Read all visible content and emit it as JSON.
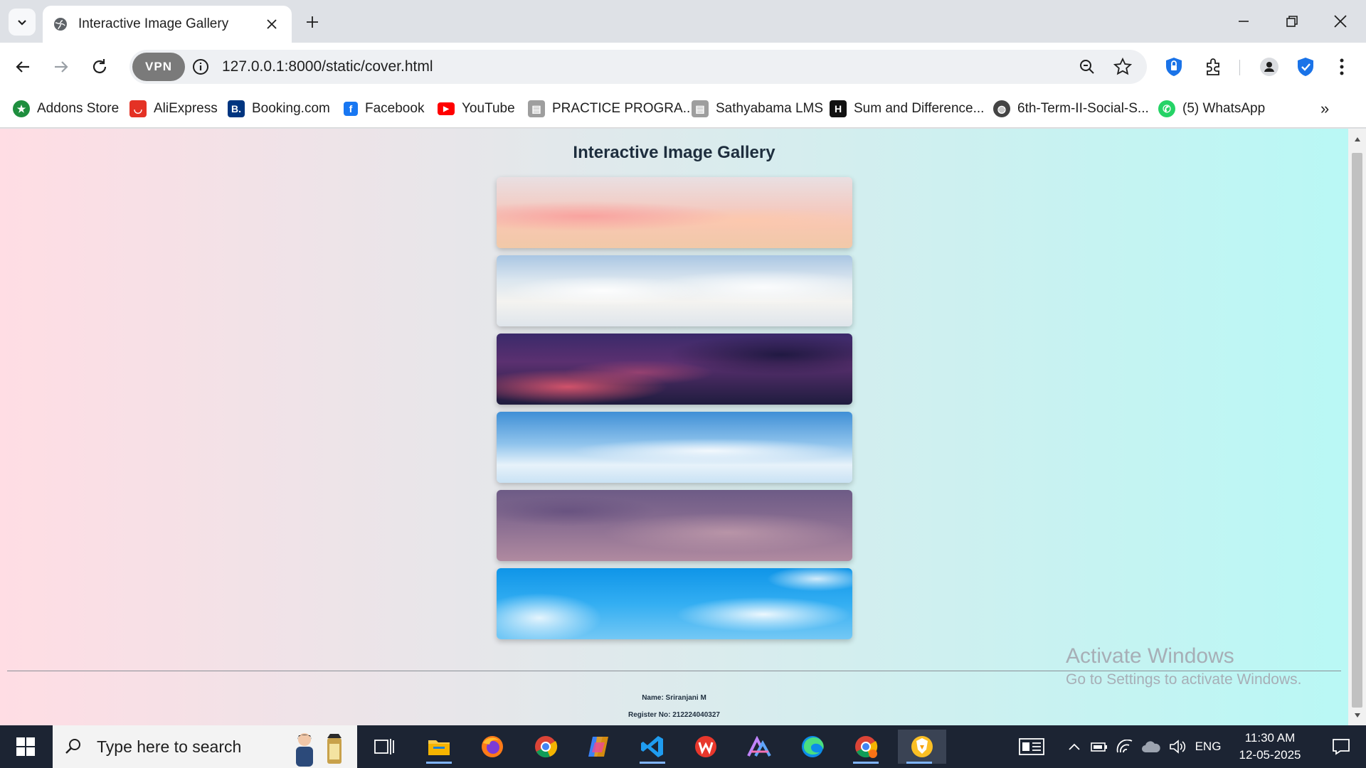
{
  "browser": {
    "tab_title": "Interactive Image Gallery",
    "url": "127.0.0.1:8000/static/cover.html",
    "vpn_label": "VPN",
    "bookmarks": [
      {
        "label": "Addons Store",
        "icon": "addons-store-icon",
        "color": "#1e8e3e"
      },
      {
        "label": "AliExpress",
        "icon": "aliexpress-icon",
        "color": "#e43225"
      },
      {
        "label": "Booking.com",
        "icon": "booking-icon",
        "color": "#003580"
      },
      {
        "label": "Facebook",
        "icon": "facebook-icon",
        "color": "#1877f2"
      },
      {
        "label": "YouTube",
        "icon": "youtube-icon",
        "color": "#ff0000"
      },
      {
        "label": "PRACTICE PROGRA...",
        "icon": "page-icon",
        "color": "#8a8a8a"
      },
      {
        "label": "Sathyabama LMS",
        "icon": "page-icon",
        "color": "#8a8a8a"
      },
      {
        "label": "Sum and Difference...",
        "icon": "h-logo-icon",
        "color": "#111111"
      },
      {
        "label": "6th-Term-II-Social-S...",
        "icon": "globe-icon",
        "color": "#444444"
      },
      {
        "label": "(5) WhatsApp",
        "icon": "whatsapp-icon",
        "color": "#25d366"
      }
    ]
  },
  "page": {
    "title": "Interactive Image Gallery",
    "images": [
      {
        "name": "pink-sunset-sky"
      },
      {
        "name": "white-clouds-sky"
      },
      {
        "name": "purple-dusk-sky"
      },
      {
        "name": "light-blue-sky"
      },
      {
        "name": "mauve-cloudy-sky"
      },
      {
        "name": "bright-blue-sky"
      }
    ],
    "footer_name": "Name: Sriranjani M",
    "footer_register": "Register No: 212224040327"
  },
  "watermark": {
    "line1": "Activate Windows",
    "line2": "Go to Settings to activate Windows."
  },
  "taskbar": {
    "search_placeholder": "Type here to search",
    "language": "ENG",
    "time": "11:30 AM",
    "date": "12-05-2025"
  },
  "colors": {
    "gradient_left": "#ffdde4",
    "gradient_right": "#b9f8f5",
    "title_text": "#1e2e3e",
    "taskbar_bg": "#1c2433"
  }
}
